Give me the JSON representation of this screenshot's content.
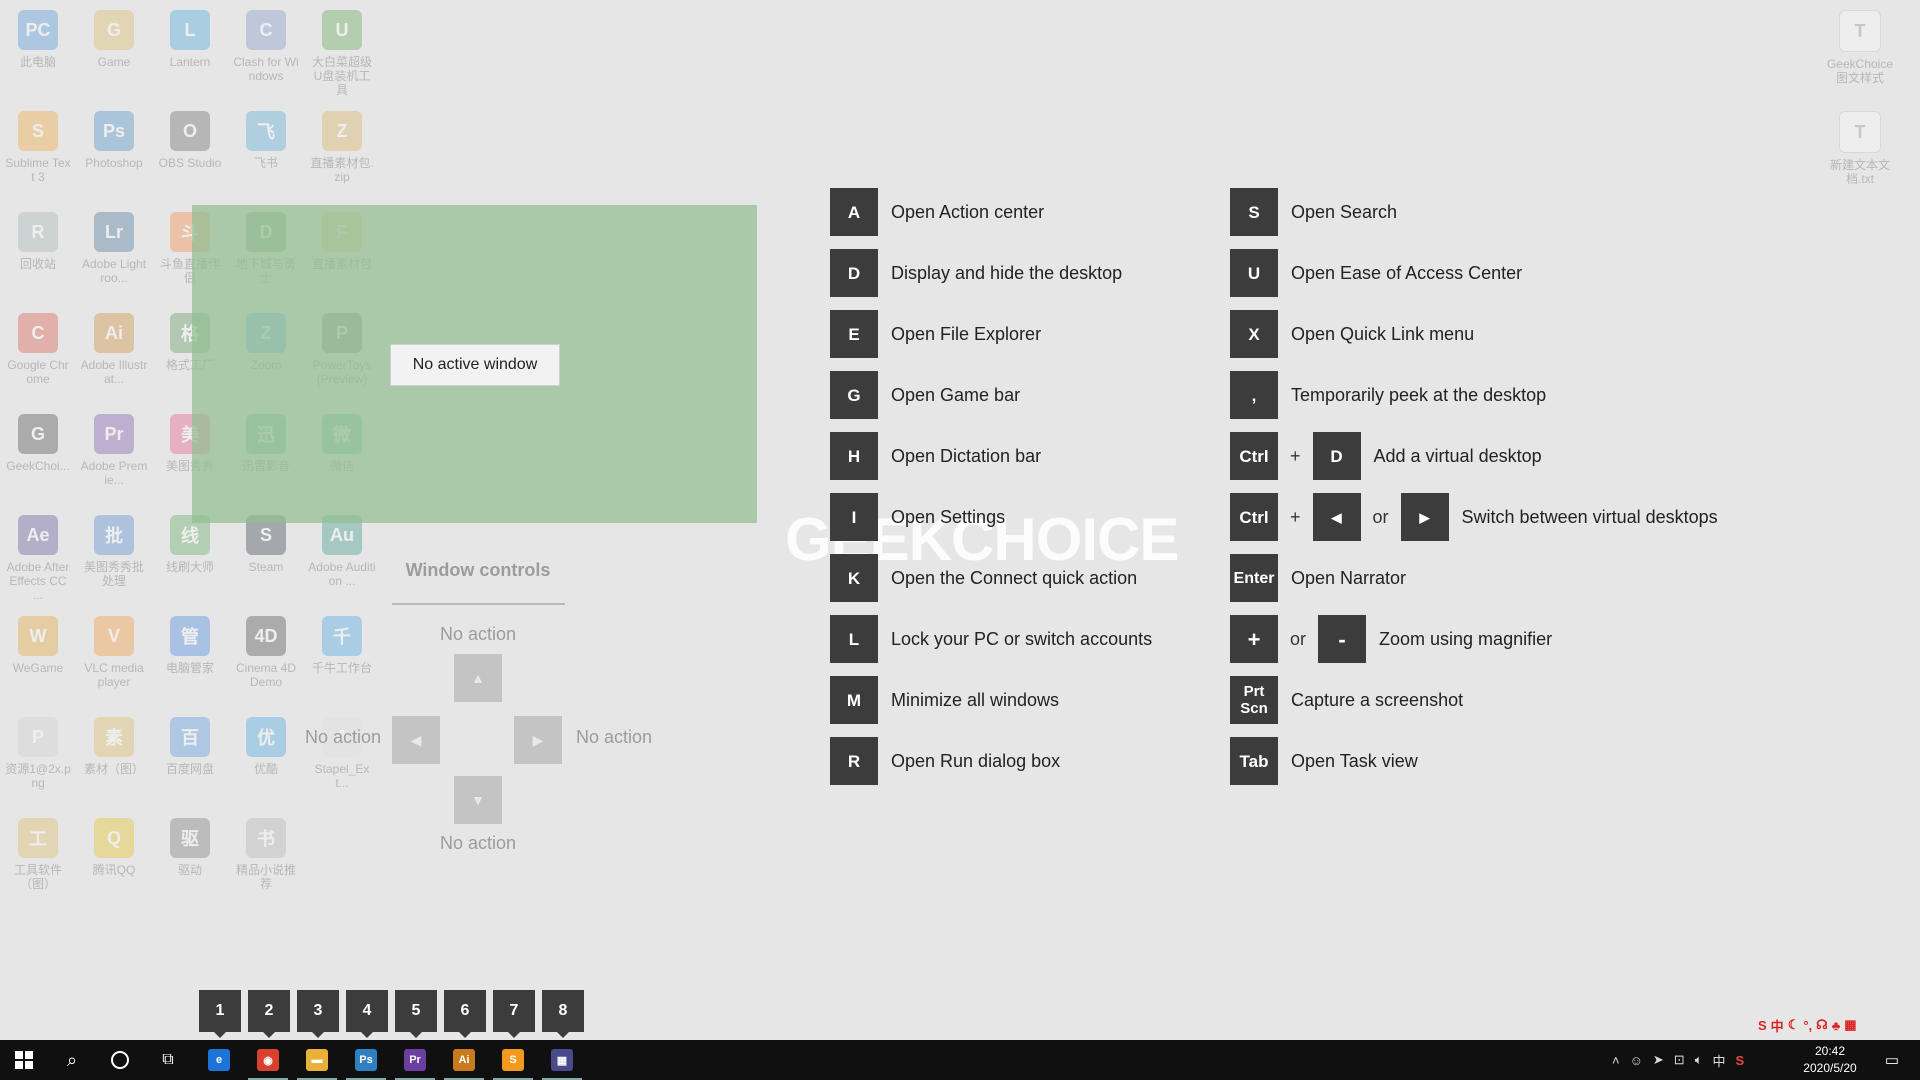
{
  "desktop": {
    "icons": [
      {
        "label": "此电脑",
        "color": "#3b87d6",
        "glyph": "PC"
      },
      {
        "label": "Game",
        "color": "#d9b24a",
        "glyph": "G"
      },
      {
        "label": "Lantern",
        "color": "#2a9ad8",
        "glyph": "L"
      },
      {
        "label": "Clash for Windows",
        "color": "#6f8bc6",
        "glyph": "C"
      },
      {
        "label": "大白菜超级U盘装机工具",
        "color": "#4c9a3a",
        "glyph": "U"
      },
      {
        "label": "Sublime Text 3",
        "color": "#f29a1d",
        "glyph": "S"
      },
      {
        "label": "Photoshop",
        "color": "#2f7fc1",
        "glyph": "Ps"
      },
      {
        "label": "OBS Studio",
        "color": "#555",
        "glyph": "O"
      },
      {
        "label": "飞书",
        "color": "#3fa0d8",
        "glyph": "飞"
      },
      {
        "label": "直播素材包.zip",
        "color": "#d9a84a",
        "glyph": "Z"
      },
      {
        "label": "回收站",
        "color": "#9aa",
        "glyph": "R"
      },
      {
        "label": "Adobe Lightroo...",
        "color": "#2b5f8f",
        "glyph": "Lr"
      },
      {
        "label": "斗鱼直播伴侣",
        "color": "#f07a2a",
        "glyph": "斗"
      },
      {
        "label": "地下城与勇士",
        "color": "#4b7a3a",
        "glyph": "D"
      },
      {
        "label": "直播素材包",
        "color": "#d9b24a",
        "glyph": "F"
      },
      {
        "label": "Google Chrome",
        "color": "#d9412f",
        "glyph": "C"
      },
      {
        "label": "Adobe Illustrat...",
        "color": "#c77b1c",
        "glyph": "Ai"
      },
      {
        "label": "格式工厂",
        "color": "#4a8a4a",
        "glyph": "格"
      },
      {
        "label": "Zoom",
        "color": "#2d8cff",
        "glyph": "Z"
      },
      {
        "label": "PowerToys (Preview)",
        "color": "#444",
        "glyph": "P"
      },
      {
        "label": "GeekChoi...",
        "color": "#333",
        "glyph": "G"
      },
      {
        "label": "Adobe Premie...",
        "color": "#6b3fa0",
        "glyph": "Pr"
      },
      {
        "label": "美图秀秀",
        "color": "#e0407a",
        "glyph": "美"
      },
      {
        "label": "迅雷影音",
        "color": "#2f9a5a",
        "glyph": "迅"
      },
      {
        "label": "微信",
        "color": "#2aae67",
        "glyph": "微"
      },
      {
        "label": "Adobe After Effects CC ...",
        "color": "#4a3f8a",
        "glyph": "Ae"
      },
      {
        "label": "美图秀秀批处理",
        "color": "#3a7ad0",
        "glyph": "批"
      },
      {
        "label": "线刷大师",
        "color": "#4aa04a",
        "glyph": "线"
      },
      {
        "label": "Steam",
        "color": "#1b2838",
        "glyph": "S"
      },
      {
        "label": "Adobe Audition ...",
        "color": "#1f8a7a",
        "glyph": "Au"
      },
      {
        "label": "WeGame",
        "color": "#e09a1a",
        "glyph": "W"
      },
      {
        "label": "VLC media player",
        "color": "#f08a1a",
        "glyph": "V"
      },
      {
        "label": "电脑管家",
        "color": "#2a7ae0",
        "glyph": "管"
      },
      {
        "label": "Cinema 4D Demo",
        "color": "#333",
        "glyph": "4D"
      },
      {
        "label": "千牛工作台",
        "color": "#2a9ae0",
        "glyph": "千"
      },
      {
        "label": "资源1@2x.png",
        "color": "#ccc",
        "glyph": "P"
      },
      {
        "label": "素材（图）",
        "color": "#d9b24a",
        "glyph": "素"
      },
      {
        "label": "百度网盘",
        "color": "#3a8ae0",
        "glyph": "百"
      },
      {
        "label": "优酷",
        "color": "#2a9ae0",
        "glyph": "优"
      },
      {
        "label": "Stapel_Ext...",
        "color": "#ddd",
        "glyph": "A"
      },
      {
        "label": "工具软件（图）",
        "color": "#d9b24a",
        "glyph": "工"
      },
      {
        "label": "腾讯QQ",
        "color": "#e6b800",
        "glyph": "Q"
      },
      {
        "label": "驱动",
        "color": "#666",
        "glyph": "驱"
      },
      {
        "label": "精品小说推荐",
        "color": "#aaa",
        "glyph": "书"
      }
    ],
    "right_icons": [
      {
        "label": "GeekChoice图文样式",
        "color": "#ddd",
        "glyph": "T"
      },
      {
        "label": "新建文本文档.txt",
        "color": "#ddd",
        "glyph": "T"
      }
    ]
  },
  "snap": {
    "no_active_label": "No active window"
  },
  "window_controls": {
    "title": "Window controls",
    "top_label": "No action",
    "left_label": "No action",
    "right_label": "No action",
    "bottom_label": "No action"
  },
  "watermark": "GEEKCHOICE",
  "shortcuts_left": [
    {
      "key": "A",
      "desc": "Open Action center"
    },
    {
      "key": "D",
      "desc": "Display and hide the desktop"
    },
    {
      "key": "E",
      "desc": "Open File Explorer"
    },
    {
      "key": "G",
      "desc": "Open Game bar"
    },
    {
      "key": "H",
      "desc": "Open Dictation bar"
    },
    {
      "key": "I",
      "desc": "Open Settings"
    },
    {
      "key": "K",
      "desc": "Open the Connect quick action"
    },
    {
      "key": "L",
      "desc": "Lock your PC or switch accounts"
    },
    {
      "key": "M",
      "desc": "Minimize all windows"
    },
    {
      "key": "R",
      "desc": "Open Run dialog box"
    }
  ],
  "shortcuts_right": {
    "s": {
      "key": "S",
      "desc": "Open Search"
    },
    "u": {
      "key": "U",
      "desc": "Open Ease of Access Center"
    },
    "x": {
      "key": "X",
      "desc": "Open Quick Link menu"
    },
    "comma": {
      "key": ",",
      "desc": "Temporarily peek at the desktop"
    },
    "virtual_add": {
      "key1": "Ctrl",
      "plus": "+",
      "key2": "D",
      "desc": "Add a virtual desktop"
    },
    "virtual_switch": {
      "key1": "Ctrl",
      "plus": "+",
      "key2": "◀",
      "or": "or",
      "key3": "▶",
      "desc": "Switch between virtual desktops"
    },
    "enter": {
      "key": "Enter",
      "desc": "Open Narrator"
    },
    "zoom": {
      "key1": "+",
      "or": "or",
      "key2": "-",
      "desc": "Zoom using magnifier"
    },
    "prtscn": {
      "key_line1": "Prt",
      "key_line2": "Scn",
      "desc": "Capture a screenshot"
    },
    "tab": {
      "key": "Tab",
      "desc": "Open Task view"
    }
  },
  "taskbar_numbers": [
    "1",
    "2",
    "3",
    "4",
    "5",
    "6",
    "7",
    "8"
  ],
  "taskbar": {
    "apps": [
      {
        "name": "edge",
        "label": "e",
        "color": "#1e73d8"
      },
      {
        "name": "chrome",
        "label": "◉",
        "color": "#d9412f"
      },
      {
        "name": "explorer",
        "label": "▬",
        "color": "#e8b23a"
      },
      {
        "name": "photoshop",
        "label": "Ps",
        "color": "#2f7fc1"
      },
      {
        "name": "premiere",
        "label": "Pr",
        "color": "#6b3fa0"
      },
      {
        "name": "illustrator",
        "label": "Ai",
        "color": "#c77b1c"
      },
      {
        "name": "sublime",
        "label": "S",
        "color": "#f29a1d"
      },
      {
        "name": "powertoys",
        "label": "▦",
        "color": "#4a4a8a"
      }
    ],
    "ime_label": "中",
    "ime_bar": [
      "S",
      "中",
      "☾",
      "°,",
      "☊",
      "♣",
      "▦"
    ],
    "clock_time": "20:42",
    "clock_date": "2020/5/20"
  }
}
